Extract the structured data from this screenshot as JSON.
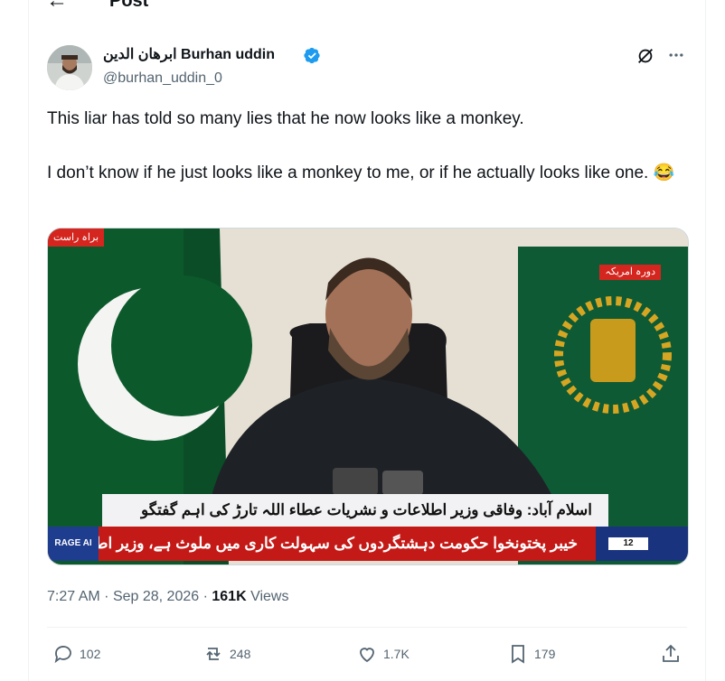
{
  "header": {
    "title": "Post",
    "back_icon": "arrow-left-icon"
  },
  "author": {
    "name": "ابرهان الدين Burhan uddin",
    "handle": "@burhan_uddin_0",
    "verified": true,
    "verified_color": "#1d9bf0"
  },
  "post": {
    "paragraph1": "This liar has told so many lies that he now looks like a monkey.",
    "paragraph2": "I don’t know if he just looks like a monkey to me, or if he actually looks like one. 😂"
  },
  "media": {
    "badge_top_left": "براہ راست",
    "badge_top_right": "دورہ امریکہ",
    "lower_third_1": "اسلام آباد: وفاقی وزیر اطلاعات و نشریات عطاء اللہ تارڑ کی اہم گفتگو",
    "lower_third_2": "خیبر پختونخوا حکومت دہشتگردوں کی سہولت کاری میں ملوث ہے، وزیر اطلاعات",
    "channel_tag": "RAGE AI",
    "ticker_time": "12"
  },
  "meta": {
    "time": "7:27 AM",
    "date": "Sep 28, 2026",
    "views_count": "161K",
    "views_label": "Views"
  },
  "actions": {
    "replies": "102",
    "reposts": "248",
    "likes": "1.7K",
    "bookmarks": "179"
  },
  "colors": {
    "text_primary": "#0f1419",
    "text_secondary": "#536471",
    "border": "#eff3f4",
    "news_red": "#c41a17",
    "news_blue": "#19337e"
  }
}
